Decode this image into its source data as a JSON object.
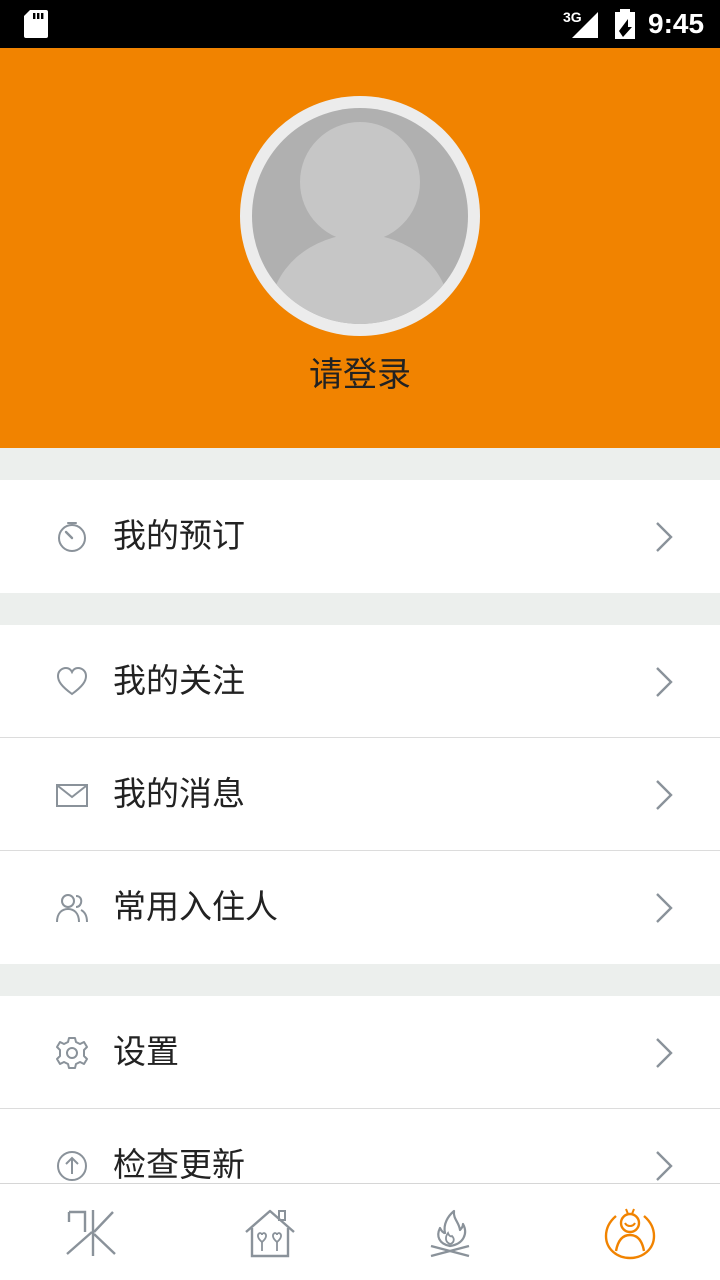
{
  "status_bar": {
    "time": "9:45",
    "network_label": "3G",
    "icons": [
      "sd-card-icon",
      "signal-icon",
      "battery-icon"
    ]
  },
  "profile": {
    "login_prompt": "请登录"
  },
  "menu": {
    "groups": [
      [
        {
          "label": "我的预订",
          "icon": "timer-icon"
        }
      ],
      [
        {
          "label": "我的关注",
          "icon": "heart-icon"
        },
        {
          "label": "我的消息",
          "icon": "mail-icon"
        },
        {
          "label": "常用入住人",
          "icon": "people-icon"
        }
      ],
      [
        {
          "label": "设置",
          "icon": "gear-icon"
        },
        {
          "label": "检查更新",
          "icon": "upload-icon"
        }
      ]
    ]
  },
  "bottom_nav": {
    "items": [
      {
        "icon": "logo-icon",
        "active": false
      },
      {
        "icon": "home-icon",
        "active": false
      },
      {
        "icon": "campfire-icon",
        "active": false
      },
      {
        "icon": "profile-icon",
        "active": true
      }
    ]
  },
  "colors": {
    "brand": "#f18300",
    "background": "#ecefed",
    "icon_gray": "#8a929a"
  }
}
